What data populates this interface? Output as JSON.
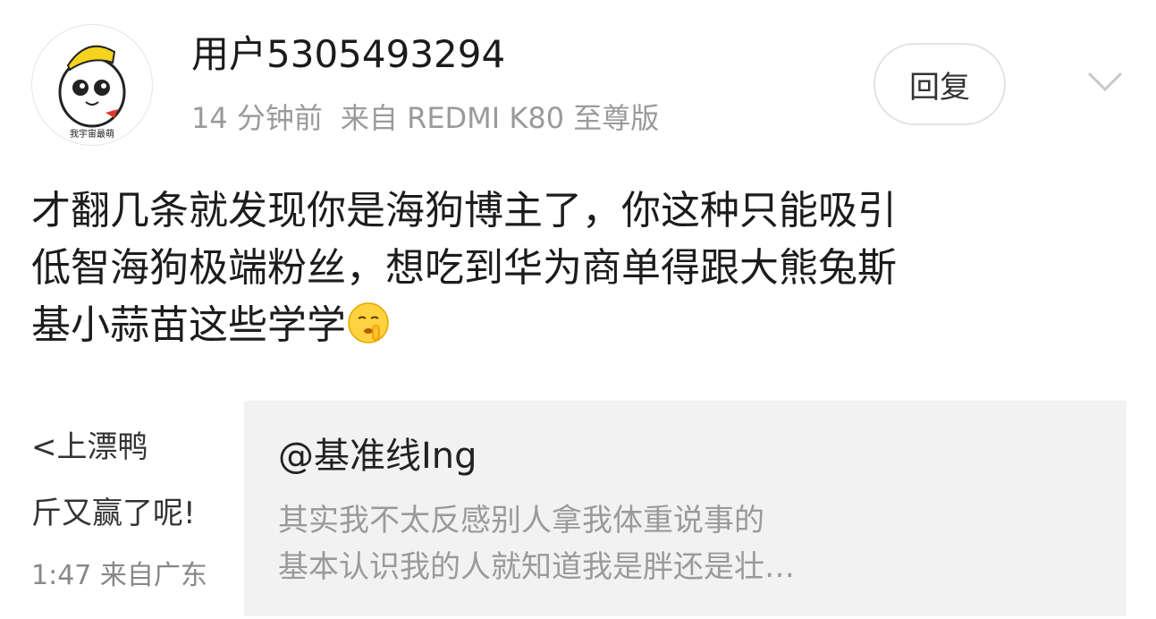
{
  "post": {
    "username": "用户5305493294",
    "time": "14 分钟前",
    "source": "来自 REDMI K80 至尊版",
    "reply_label": "回复",
    "avatar_text": "我宇宙最萌",
    "content_lines": [
      "才翻几条就发现你是海狗博主了，你这种只能吸引",
      "低智海狗极端粉丝，想吃到华为商单得跟大熊兔斯",
      "基小蒜苗这些学学"
    ],
    "emoji": "shush-face-icon"
  },
  "quote": {
    "thumb_lines": [
      "<上漂鸭",
      "斤又赢了呢!",
      "1:47 来自广东"
    ],
    "title": "@基准线Ing",
    "body_lines": [
      "其实我不太反感别人拿我体重说事的",
      "基本认识我的人就知道我是胖还是壮…"
    ]
  }
}
